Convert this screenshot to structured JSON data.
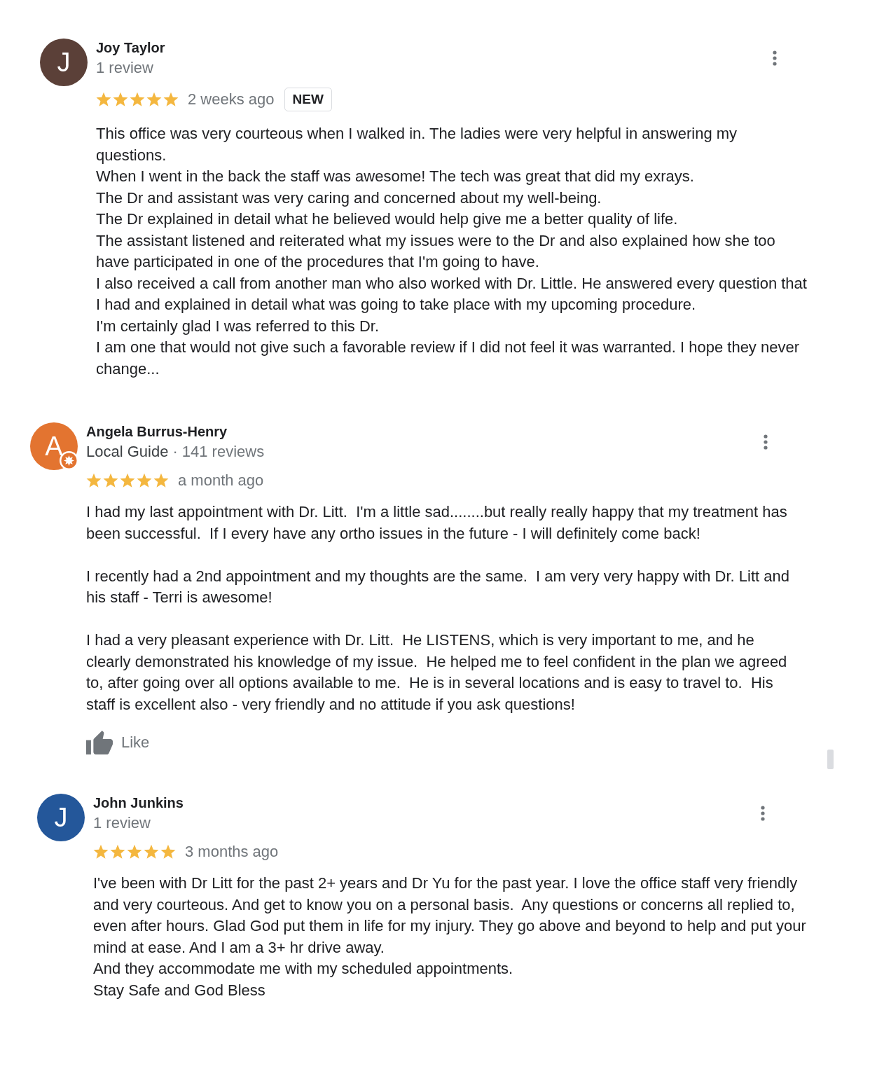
{
  "reviews": [
    {
      "avatar": {
        "letter": "J",
        "color": "#5b4038"
      },
      "local_guide": false,
      "name": "Joy Taylor",
      "review_count": "1 review",
      "stars": 5,
      "date": "2 weeks ago",
      "badge": "NEW",
      "text": "This office was very courteous when I walked in. The ladies were very helpful in answering my\nquestions.\nWhen I went in the back the staff was awesome! The tech was great that did my exrays.\nThe Dr and assistant was very caring and concerned about my well-being.\nThe Dr explained in detail what he believed would help give me a better quality of life.\nThe assistant listened and reiterated what my issues were to the Dr and also explained how she too\nhave participated in one of the procedures that I'm going to have.\nI also received a call from another man who also worked with Dr. Little. He answered every question that\nI had and explained in detail what was going to take place with my upcoming procedure.\nI'm certainly glad I was referred to this Dr.\nI am one that would not give such a favorable review if I did not feel it was warranted. I hope they never\nchange..."
    },
    {
      "avatar": {
        "letter": "A",
        "color": "#e37430"
      },
      "local_guide": true,
      "name": "Angela Burrus-Henry",
      "level_label": "Local Guide",
      "separator": "·",
      "review_count": "141 reviews",
      "stars": 5,
      "date": "a month ago",
      "text": "I had my last appointment with Dr. Litt.  I'm a little sad........but really really happy that my treatment has\nbeen successful.  If I every have any ortho issues in the future - I will definitely come back!\n\nI recently had a 2nd appointment and my thoughts are the same.  I am very very happy with Dr. Litt and\nhis staff - Terri is awesome!\n\nI had a very pleasant experience with Dr. Litt.  He LISTENS, which is very important to me, and he\nclearly demonstrated his knowledge of my issue.  He helped me to feel confident in the plan we agreed\nto, after going over all options available to me.  He is in several locations and is easy to travel to.  His\nstaff is excellent also - very friendly and no attitude if you ask questions!",
      "like_label": "Like"
    },
    {
      "avatar": {
        "letter": "J",
        "color": "#24579a"
      },
      "local_guide": false,
      "name": "John Junkins",
      "review_count": "1 review",
      "stars": 5,
      "date": "3 months ago",
      "text": "I've been with Dr Litt for the past 2+ years and Dr Yu for the past year. I love the office staff very friendly\nand very courteous. And get to know you on a personal basis.  Any questions or concerns all replied to,\neven after hours. Glad God put them in life for my injury. They go above and beyond to help and put your\nmind at ease. And I am a 3+ hr drive away.\nAnd they accommodate me with my scheduled appointments.\nStay Safe and God Bless"
    }
  ]
}
